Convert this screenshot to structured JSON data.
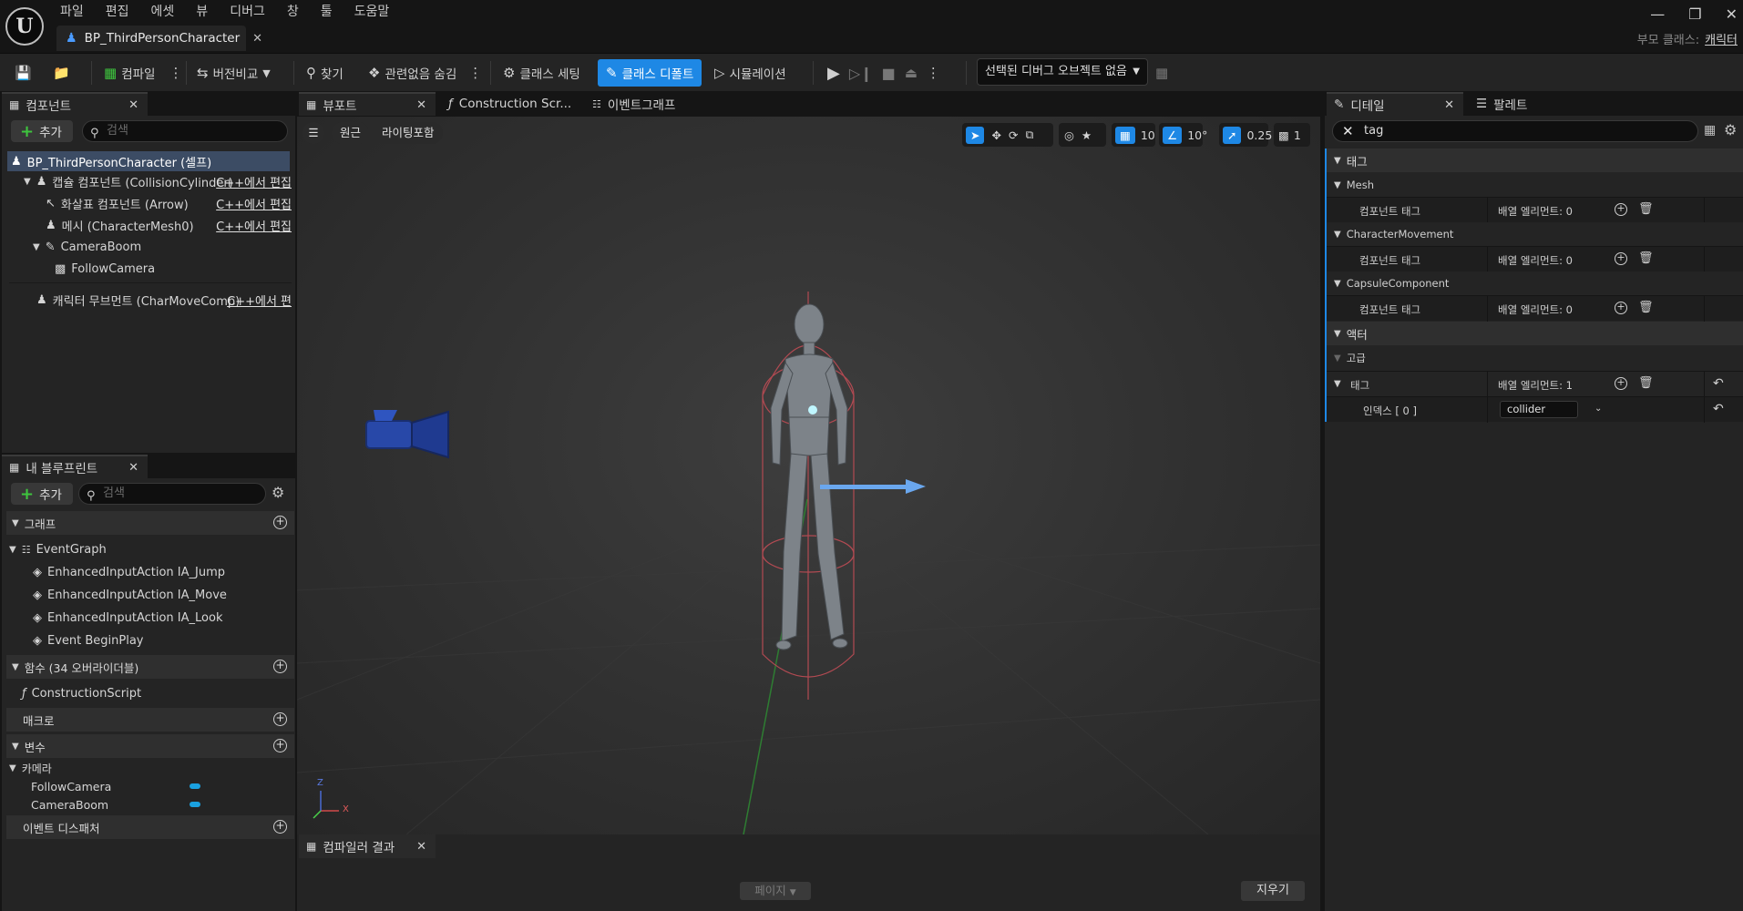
{
  "menu": [
    "파일",
    "편집",
    "에셋",
    "뷰",
    "디버그",
    "창",
    "툴",
    "도움말"
  ],
  "document_tab": "BP_ThirdPersonCharacter",
  "parent_class": {
    "label": "부모 클래스:",
    "value": "캐릭터"
  },
  "toolbar": {
    "compile": "컴파일",
    "diff": "버전비교",
    "find": "찾기",
    "hide_unrelated": "관련없음 숨김",
    "class_settings": "클래스 세팅",
    "class_defaults": "클래스 디폴트",
    "simulation": "시뮬레이션",
    "debug_object": "선택된 디버그 오브젝트 없음"
  },
  "components": {
    "tab": "컴포넌트",
    "add": "추가",
    "search_placeholder": "검색",
    "root": "BP_ThirdPersonCharacter (셀프)",
    "items": [
      {
        "label": "캡슐 컴포넌트 (CollisionCylinder)",
        "edit": "C++에서 편집"
      },
      {
        "label": "화살표 컴포넌트 (Arrow)",
        "edit": "C++에서 편집"
      },
      {
        "label": "메시 (CharacterMesh0)",
        "edit": "C++에서 편집"
      },
      {
        "label": "CameraBoom",
        "edit": ""
      },
      {
        "label": "FollowCamera",
        "edit": ""
      },
      {
        "label": "캐릭터 무브먼트 (CharMoveComp)",
        "edit": "C++에서 편"
      }
    ]
  },
  "my_blueprint": {
    "tab": "내 블루프린트",
    "add": "추가",
    "search_placeholder": "검색",
    "graphs_header": "그래프",
    "event_graph": "EventGraph",
    "events": [
      "EnhancedInputAction IA_Jump",
      "EnhancedInputAction IA_Move",
      "EnhancedInputAction IA_Look",
      "Event BeginPlay"
    ],
    "functions_header": "함수 (34 오버라이더블)",
    "construction_script": "ConstructionScript",
    "macros_header": "매크로",
    "variables_header": "변수",
    "camera_category": "카메라",
    "variables": [
      "FollowCamera",
      "CameraBoom"
    ],
    "dispatchers_header": "이벤트 디스패처"
  },
  "editor_tabs": [
    "뷰포트",
    "Construction Scr...",
    "이벤트그래프"
  ],
  "viewport": {
    "perspective": "원근",
    "lighting": "라이팅포함",
    "grid_snap": "10",
    "rotation_snap": "10°",
    "scale_snap": "0.25",
    "camera_speed": "1",
    "axis_z": "Z",
    "axis_x": "X"
  },
  "compiler": {
    "tab": "컴파일러 결과",
    "pages": "페이지",
    "clear": "지우기"
  },
  "details": {
    "tab": "디테일",
    "palette_tab": "팔레트",
    "search_value": "tag",
    "section_tags": "태그",
    "mesh": "Mesh",
    "character_movement": "CharacterMovement",
    "capsule_component": "CapsuleComponent",
    "component_tags_label": "컴포넌트 태그",
    "array_zero": "배열 엘리먼트: 0",
    "section_actor": "액터",
    "advanced": "고급",
    "tags_label": "태그",
    "array_one": "배열 엘리먼트: 1",
    "index_label": "인덱스 [ 0 ]",
    "index_value": "collider"
  },
  "colors": {
    "accent": "#1e88e5",
    "play": "#3ec53e",
    "selection": "#3c4c64"
  }
}
